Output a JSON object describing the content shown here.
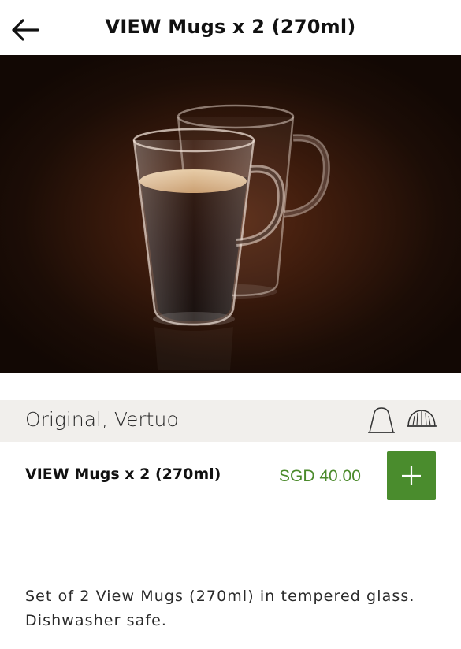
{
  "header": {
    "back_icon": "arrow-left-icon",
    "title": "VIEW Mugs x 2 (270ml)"
  },
  "hero": {
    "image_subject": "two glass mugs, one filled with coffee",
    "background_color": "#3a1a0c"
  },
  "compatibility": {
    "text": "Original, Vertuo",
    "icons": [
      "original-capsule-icon",
      "vertuo-capsule-icon"
    ]
  },
  "product": {
    "name": "VIEW Mugs x 2 (270ml)",
    "price": "SGD 40.00",
    "add_icon": "plus-icon",
    "price_color": "#4b8a2b",
    "button_color": "#4a8c2d"
  },
  "description": {
    "line1": "Set of 2 View Mugs (270ml) in tempered glass.",
    "line2": "Dishwasher safe."
  }
}
